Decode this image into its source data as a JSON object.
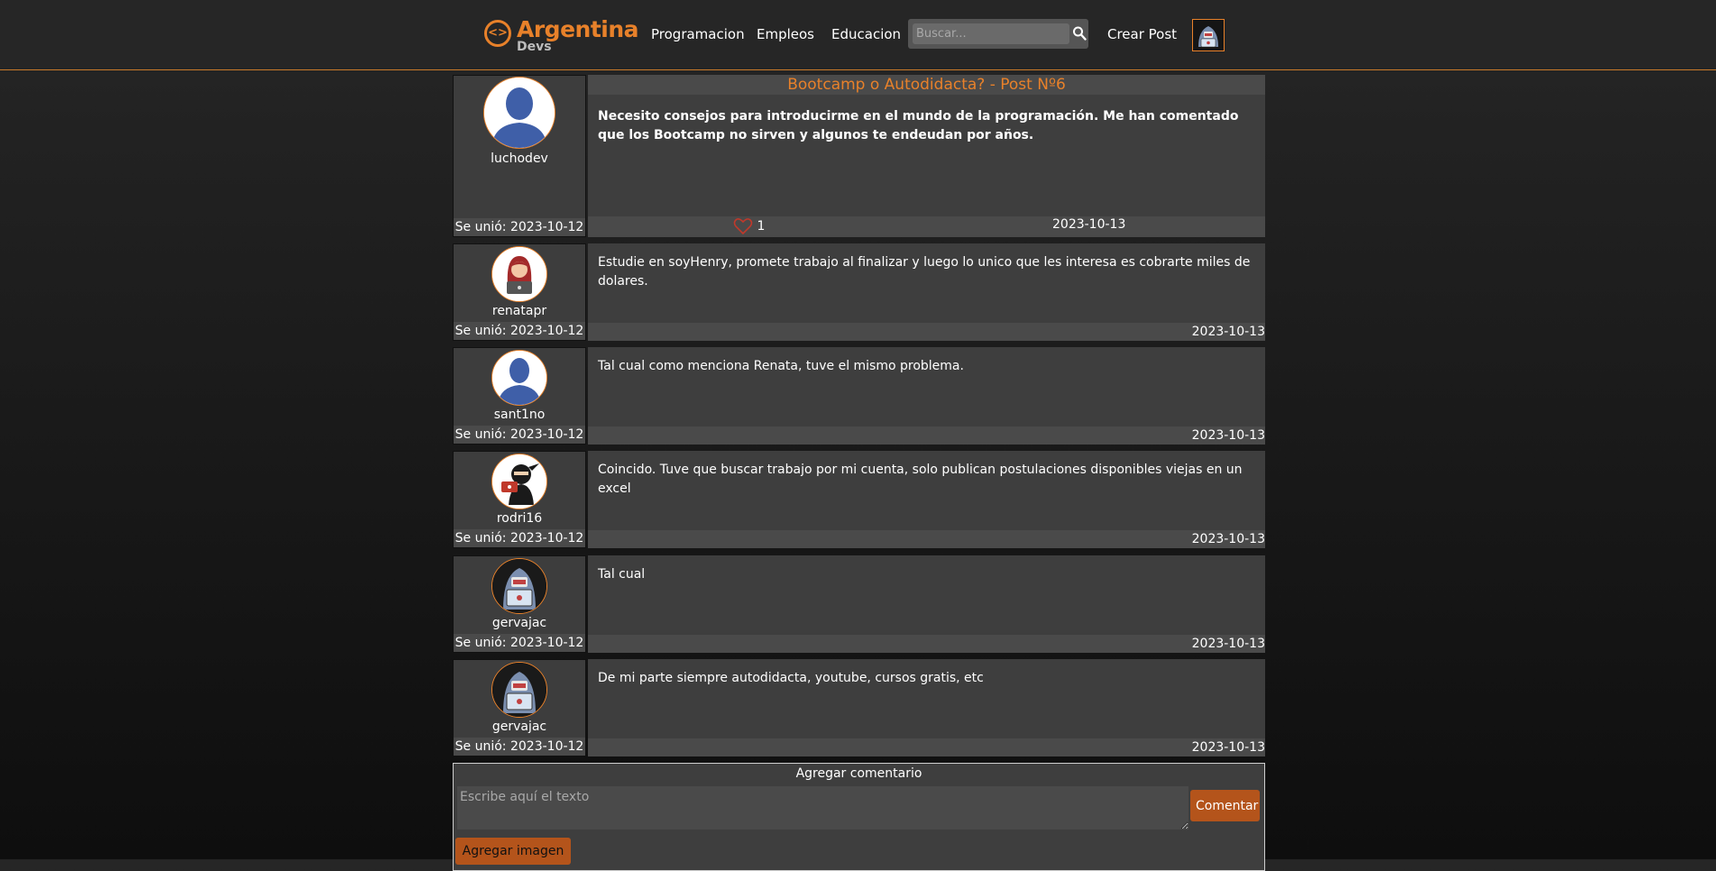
{
  "brand": {
    "name": "Argentina",
    "sub": "Devs",
    "icon": "code-brackets-icon"
  },
  "nav": {
    "links": [
      "Programacion",
      "Empleos",
      "Educacion"
    ],
    "search_placeholder": "Buscar...",
    "search_icon": "search-icon",
    "create_post": "Crear Post",
    "profile_avatar": "hooded-hacker-avatar"
  },
  "colors": {
    "accent": "#e8812a",
    "button": "#b4541b",
    "panel": "#3e3e3e",
    "bar": "#4a4a4a"
  },
  "post": {
    "title": "Bootcamp o Autodidacta? - Post Nº6",
    "author": "luchodev",
    "joined": "Se unió: 2023-10-12",
    "body": "Necesito consejos para introducirme en el mundo de la programación. Me han comentado que los Bootcamp no sirven y algunos te endeudan por años.",
    "likes": "1",
    "date": "2023-10-13"
  },
  "comments": [
    {
      "author": "renatapr",
      "joined": "Se unió: 2023-10-12",
      "text": "Estudie en soyHenry, promete trabajo al finalizar y luego lo unico que les interesa es cobrarte miles de dolares.",
      "date": "2023-10-13"
    },
    {
      "author": "sant1no",
      "joined": "Se unió: 2023-10-12",
      "text": "Tal cual como menciona Renata, tuve el mismo problema.",
      "date": "2023-10-13"
    },
    {
      "author": "rodri16",
      "joined": "Se unió: 2023-10-12",
      "text": "Coincido. Tuve que buscar trabajo por mi cuenta, solo publican postulaciones disponibles viejas en un excel",
      "date": "2023-10-13"
    },
    {
      "author": "gervajac",
      "joined": "Se unió: 2023-10-12",
      "text": "Tal cual",
      "date": "2023-10-13"
    },
    {
      "author": "gervajac",
      "joined": "Se unió: 2023-10-12",
      "text": "De mi parte siempre autodidacta, youtube, cursos gratis, etc",
      "date": "2023-10-13"
    }
  ],
  "comment_form": {
    "title": "Agregar comentario",
    "placeholder": "Escribe aquí el texto",
    "submit": "Comentar",
    "add_image": "Agregar imagen"
  }
}
